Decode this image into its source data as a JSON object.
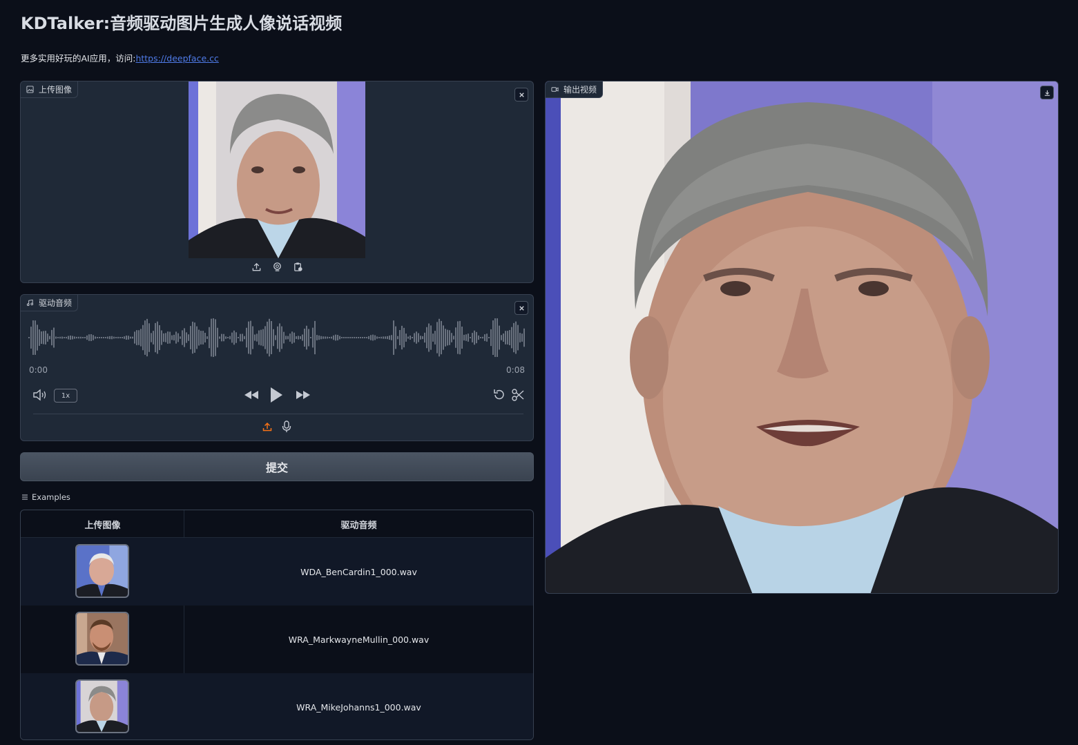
{
  "header": {
    "title": "KDTalker:音频驱动图片生成人像说话视频",
    "subtitle_prefix": "更多实用好玩的AI应用，访问:",
    "subtitle_link": "https://deepface.cc"
  },
  "upload_image": {
    "label": "上传图像",
    "clear_icon": "close-icon",
    "sources": [
      "upload-icon",
      "webcam-icon",
      "clipboard-icon"
    ]
  },
  "audio": {
    "label": "驱动音频",
    "current_time": "0:00",
    "duration": "0:08",
    "speed": "1x",
    "icons": [
      "volume-icon",
      "rewind-icon",
      "play-icon",
      "fast-forward-icon",
      "undo-icon",
      "scissors-icon",
      "upload-icon",
      "microphone-icon"
    ]
  },
  "submit": {
    "label": "提交"
  },
  "examples": {
    "label": "Examples",
    "headers": [
      "上传图像",
      "驱动音频"
    ],
    "rows": [
      {
        "audio": "WDA_BenCardin1_000.wav"
      },
      {
        "audio": "WRA_MarkwayneMullin_000.wav"
      },
      {
        "audio": "WRA_MikeJohanns1_000.wav"
      }
    ]
  },
  "output_video": {
    "label": "输出视频",
    "download_icon": "download-icon"
  },
  "colors": {
    "background": "#0b0f19",
    "panel": "#1f2937",
    "border": "#374151",
    "link": "#4f7be8",
    "accent_orange": "#f97316"
  }
}
